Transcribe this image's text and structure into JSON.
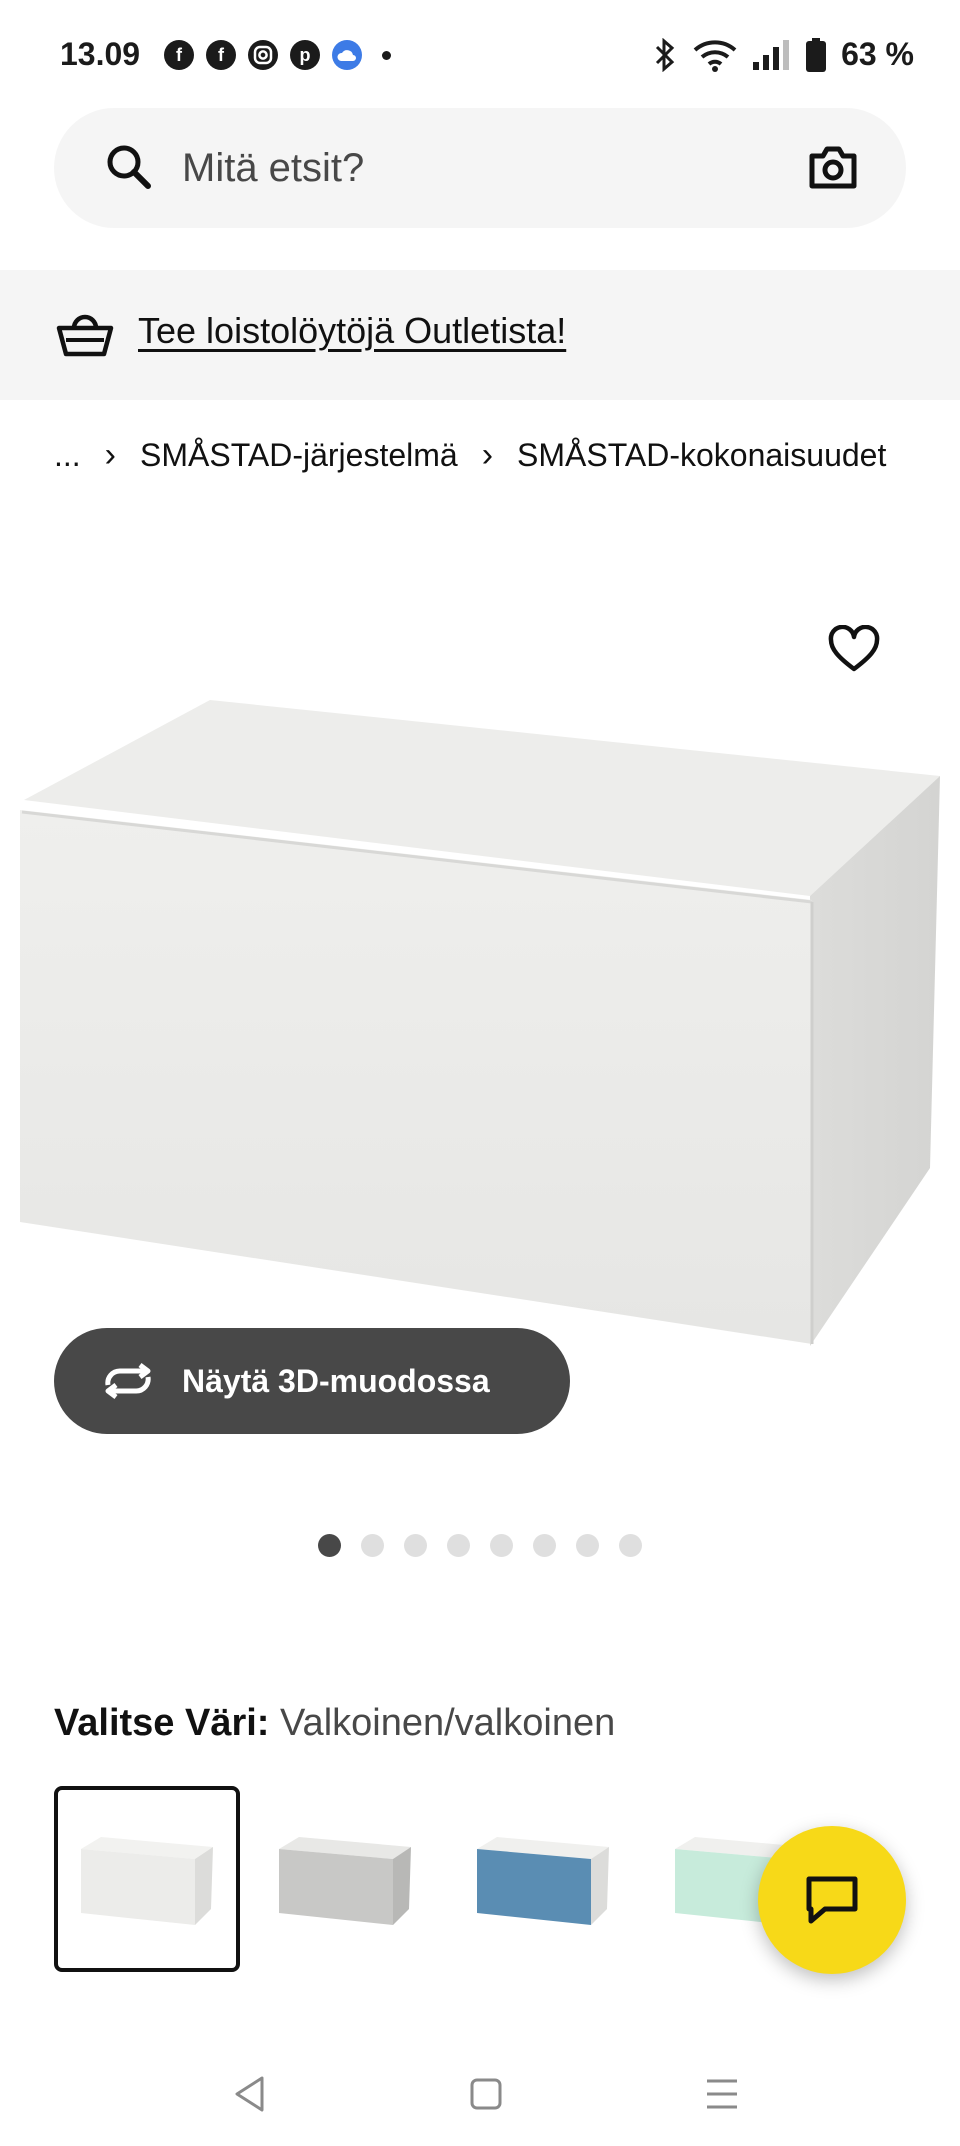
{
  "status_bar": {
    "time": "13.09",
    "battery": "63 %",
    "app_icons": [
      "facebook-icon",
      "facebook-icon",
      "instagram-icon",
      "pinterest-icon",
      "weather-icon"
    ]
  },
  "search": {
    "placeholder": "Mitä etsit?"
  },
  "outlet_banner": {
    "text": "Tee loistolöytöjä Outletista!"
  },
  "breadcrumb": {
    "items": [
      "...",
      "SMÅSTAD-järjestelmä",
      "SMÅSTAD-kokonaisuudet"
    ]
  },
  "product": {
    "view_3d_label": "Näytä 3D-muodossa",
    "image_count": 8,
    "active_image": 1
  },
  "color_choice": {
    "label": "Valitse Väri:",
    "value": "Valkoinen/valkoinen",
    "swatches": [
      {
        "name": "valkoinen/valkoinen",
        "front": "#ececea",
        "selected": true
      },
      {
        "name": "harmaa",
        "front": "#c8c8c6",
        "selected": false
      },
      {
        "name": "sininen",
        "front": "#5a8db3",
        "selected": false
      },
      {
        "name": "vihreä",
        "front": "#c7ebdb",
        "selected": false
      }
    ]
  },
  "colors": {
    "accent_yellow": "#f7d918",
    "dark_button": "#484848",
    "banner_bg": "#f5f5f5"
  }
}
